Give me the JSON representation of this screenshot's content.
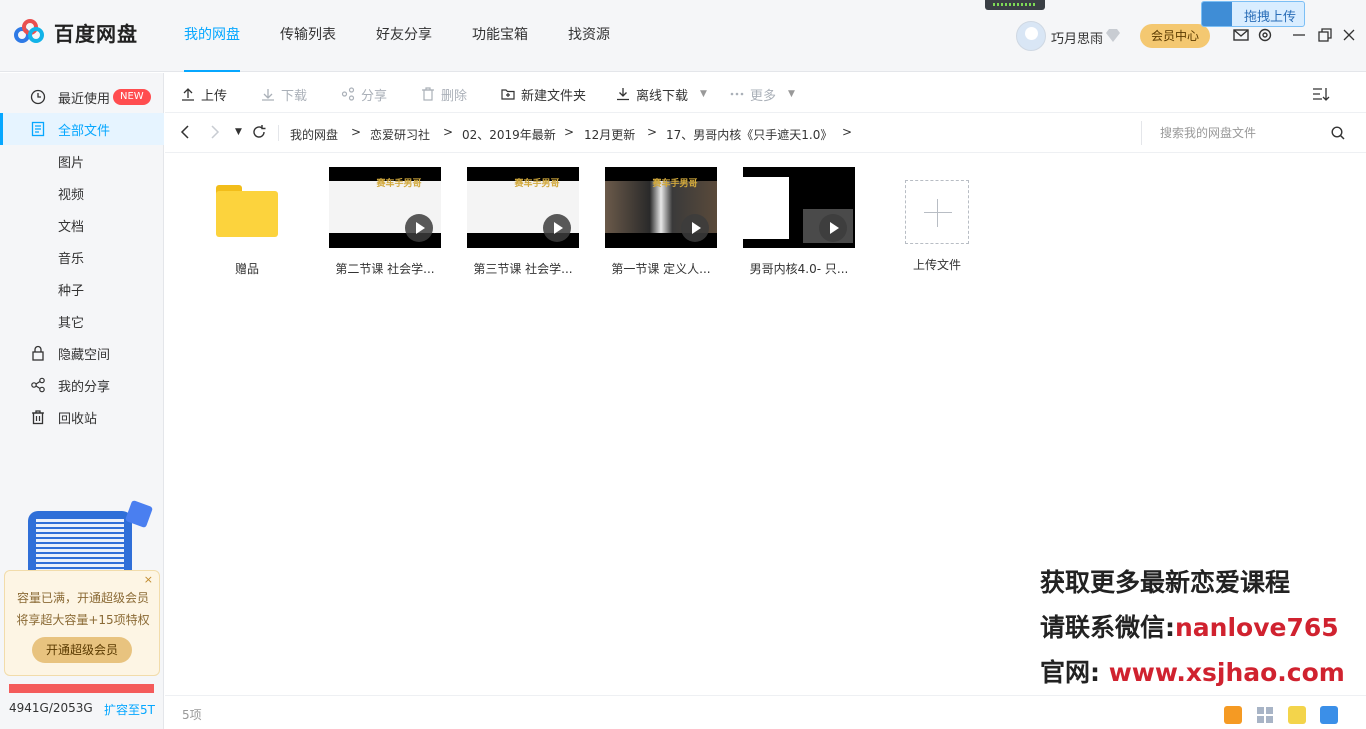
{
  "app": {
    "name": "百度网盘"
  },
  "nav": [
    "我的网盘",
    "传输列表",
    "好友分享",
    "功能宝箱",
    "找资源"
  ],
  "user": {
    "name": "巧月思雨",
    "vip_label": "会员中心"
  },
  "float_upload": {
    "label": "拖拽上传"
  },
  "sidebar": {
    "items": [
      {
        "label": "最近使用",
        "icon": "clock-icon",
        "badge": "NEW"
      },
      {
        "label": "全部文件",
        "icon": "document-icon",
        "active": true
      },
      {
        "label": "图片",
        "sub": true
      },
      {
        "label": "视频",
        "sub": true
      },
      {
        "label": "文档",
        "sub": true
      },
      {
        "label": "音乐",
        "sub": true
      },
      {
        "label": "种子",
        "sub": true
      },
      {
        "label": "其它",
        "sub": true
      },
      {
        "label": "隐藏空间",
        "icon": "lock-icon"
      },
      {
        "label": "我的分享",
        "icon": "share-icon"
      },
      {
        "label": "回收站",
        "icon": "trash-icon"
      }
    ],
    "promo": {
      "line1": "容量已满，开通超级会员",
      "line2": "将享超大容量+15项特权",
      "button": "开通超级会员"
    },
    "quota": {
      "used": "4941G/2053G",
      "expand": "扩容至5T",
      "fill_fraction": 1.0
    }
  },
  "toolbar": [
    {
      "label": "上传",
      "icon": "upload-icon",
      "enabled": true
    },
    {
      "label": "下载",
      "icon": "download-icon",
      "enabled": false
    },
    {
      "label": "分享",
      "icon": "share-icon",
      "enabled": false
    },
    {
      "label": "删除",
      "icon": "trash-icon",
      "enabled": false
    },
    {
      "label": "新建文件夹",
      "icon": "new-folder-icon",
      "enabled": true
    },
    {
      "label": "离线下载",
      "icon": "offline-download-icon",
      "enabled": true,
      "dropdown": true
    },
    {
      "label": "更多",
      "icon": "more-icon",
      "enabled": false,
      "dropdown": true
    }
  ],
  "breadcrumb": [
    "我的网盘",
    "恋爱研习社",
    "02、2019年最新",
    "12月更新",
    "17、男哥内核《只手遮天1.0》"
  ],
  "search": {
    "placeholder": "搜索我的网盘文件"
  },
  "files": [
    {
      "name": "赠品",
      "type": "folder"
    },
    {
      "name": "第二节课 社会学...",
      "type": "video",
      "thumb_text": "赛车手男哥"
    },
    {
      "name": "第三节课 社会学...",
      "type": "video",
      "thumb_text": "赛车手男哥"
    },
    {
      "name": "第一节课 定义人...",
      "type": "video",
      "thumb_text": "赛车手男哥"
    },
    {
      "name": "男哥内核4.0- 只...",
      "type": "video",
      "thumb_text": ""
    }
  ],
  "upload_tile": {
    "label": "上传文件"
  },
  "watermark": {
    "line1": "获取更多最新恋爱课程",
    "line2_prefix": "请联系微信:",
    "line2_value": "nanlove765",
    "line3_prefix": "官网: ",
    "line3_value": "www.xsjhao.com"
  },
  "status": {
    "count": "5项"
  },
  "colors": {
    "accent": "#06a7ff",
    "vip": "#f4c871",
    "quota_full": "#f45b5b"
  }
}
